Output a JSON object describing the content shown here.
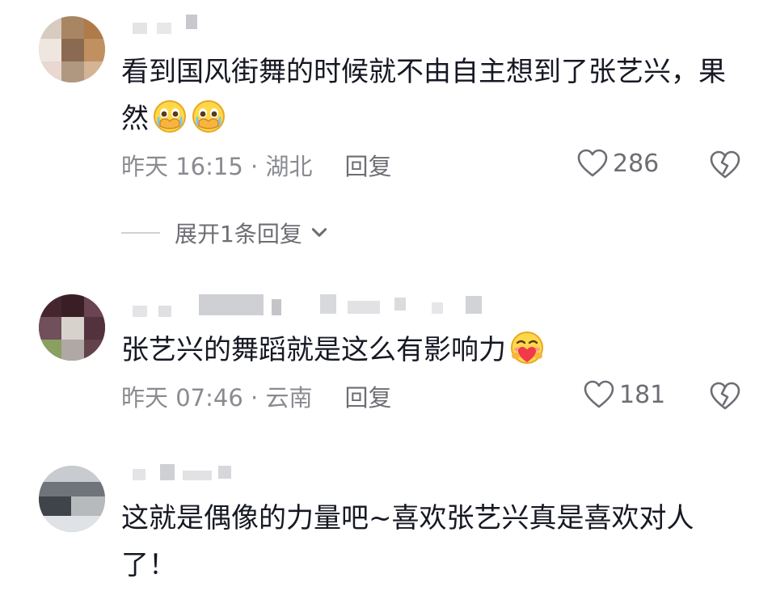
{
  "colors": {
    "text": "#161823",
    "meta": "#8a8b91",
    "action": "#6d6e74",
    "divider": "#d0d1d5"
  },
  "comments": [
    {
      "text": "看到国风街舞的时候就不由自主想到了张艺兴，果然",
      "emojis": [
        "pleading-hands-face-emoji",
        "pleading-hands-face-emoji"
      ],
      "time": "昨天 16:15 · 湖北",
      "reply_label": "回复",
      "likes": "286",
      "expand_label": "展开1条回复"
    },
    {
      "text": "张艺兴的舞蹈就是这么有影响力",
      "emojis": [
        "heart-hug-face-emoji"
      ],
      "time": "昨天 07:46 · 云南",
      "reply_label": "回复",
      "likes": "181"
    },
    {
      "text": "这就是偶像的力量吧~喜欢张艺兴真是喜欢对人了！"
    }
  ]
}
